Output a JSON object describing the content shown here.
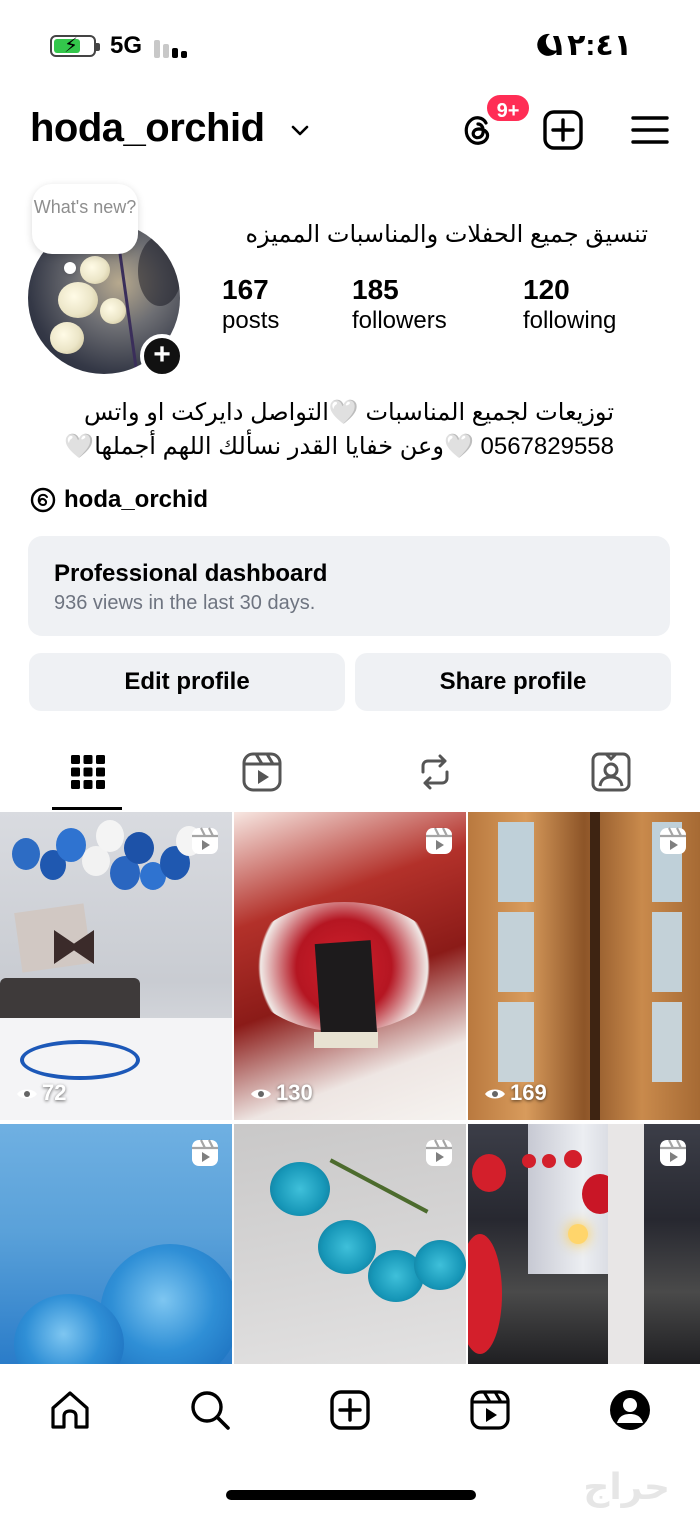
{
  "status_bar": {
    "network": "5G",
    "time": "١٢:٤١"
  },
  "header": {
    "username": "hoda_orchid",
    "threads_badge": "9+"
  },
  "profile": {
    "note": "What's new?",
    "full_name": "تنسيق جميع الحفلات والمناسبات المميزه",
    "stats": {
      "posts": {
        "value": "167",
        "label": "posts"
      },
      "followers": {
        "value": "185",
        "label": "followers"
      },
      "following": {
        "value": "120",
        "label": "following"
      }
    },
    "bio_line1": "توزيعات لجميع المناسبات 🤍التواصل دايركت او واتس",
    "bio_line2": "0567829558 🤍وعن خفايا القدر نسألك اللهم أجملها🤍",
    "threads_handle": "hoda_orchid"
  },
  "dashboard": {
    "title": "Professional dashboard",
    "subtitle": "936 views in the last 30 days."
  },
  "buttons": {
    "edit": "Edit profile",
    "share": "Share profile"
  },
  "tabs": [
    {
      "icon": "grid-icon",
      "active": true
    },
    {
      "icon": "reels-icon",
      "active": false
    },
    {
      "icon": "reposts-icon",
      "active": false
    },
    {
      "icon": "tagged-icon",
      "active": false
    }
  ],
  "posts": [
    {
      "views": "72"
    },
    {
      "views": "130"
    },
    {
      "views": "169"
    },
    {
      "views": ""
    },
    {
      "views": ""
    },
    {
      "views": ""
    }
  ],
  "bottom_nav": [
    "home-icon",
    "search-icon",
    "create-icon",
    "reels-icon",
    "profile-icon"
  ],
  "watermark": "حراج",
  "colors": {
    "accent_badge": "#ff2d55",
    "button_bg": "#eff1f4",
    "battery_green": "#33c74b"
  }
}
